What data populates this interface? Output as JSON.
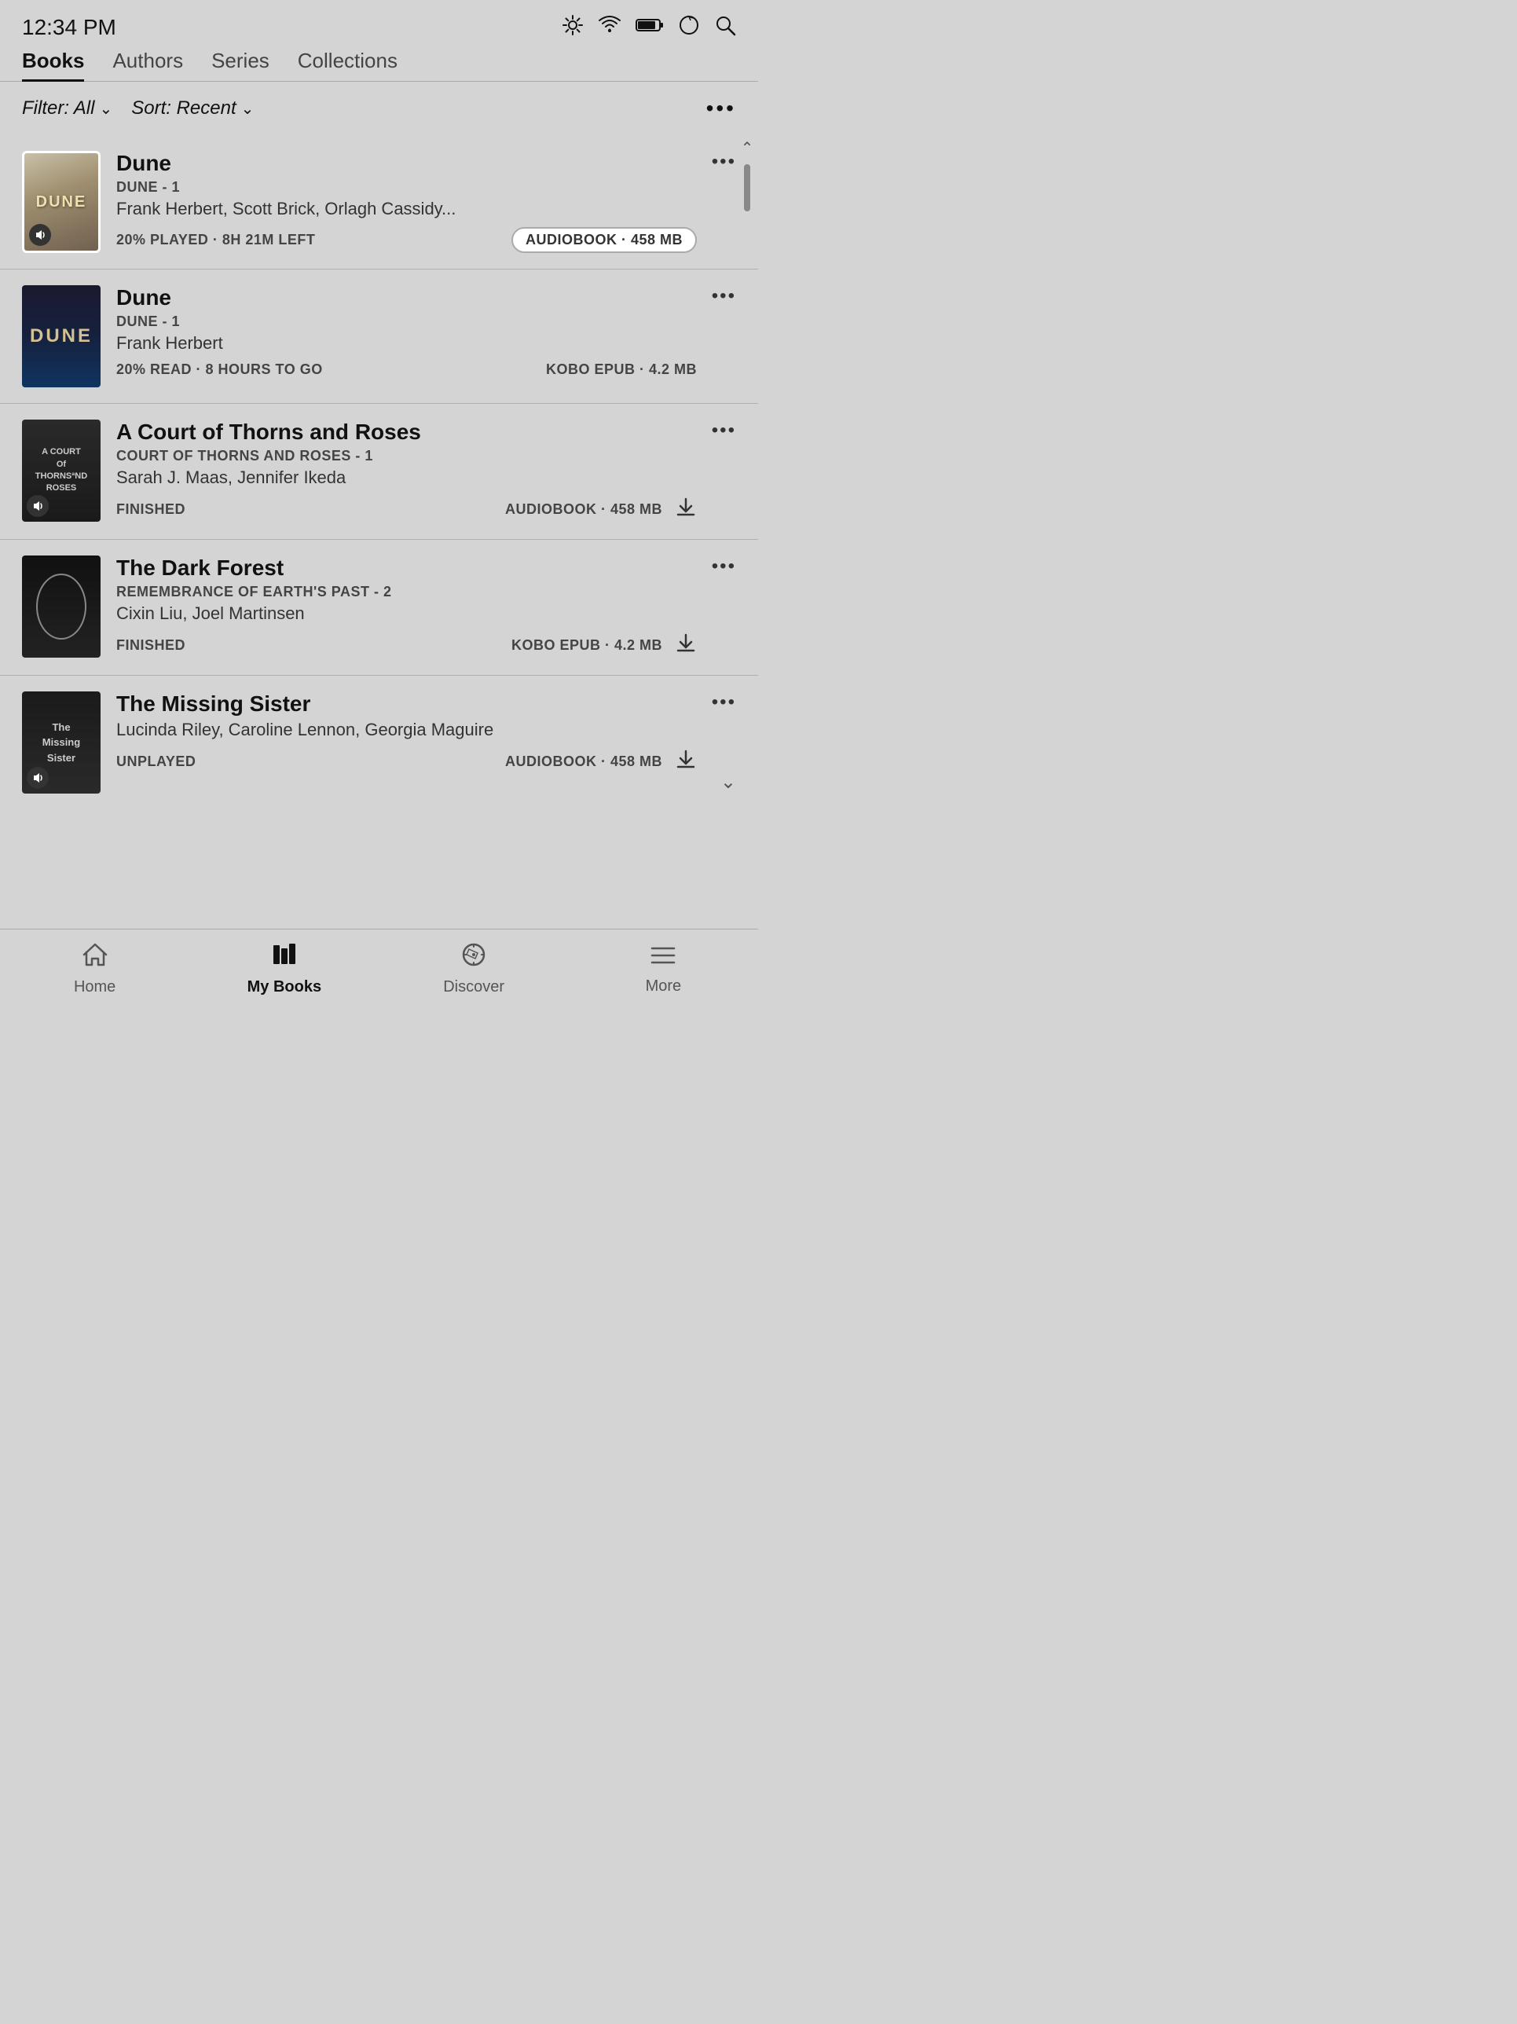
{
  "statusBar": {
    "time": "12:34 PM"
  },
  "tabs": [
    {
      "id": "books",
      "label": "Books",
      "active": true
    },
    {
      "id": "authors",
      "label": "Authors",
      "active": false
    },
    {
      "id": "series",
      "label": "Series",
      "active": false
    },
    {
      "id": "collections",
      "label": "Collections",
      "active": false
    }
  ],
  "filter": {
    "filterLabel": "Filter: All",
    "sortLabel": "Sort: Recent"
  },
  "books": [
    {
      "id": "dune-audio",
      "title": "Dune",
      "series": "DUNE - 1",
      "authors": "Frank Herbert, Scott Brick, Orlagh Cassidy...",
      "progress": "20% PLAYED · 8H 21M LEFT",
      "format": "AUDIOBOOK · 458 MB",
      "formatType": "audiobook-badge",
      "coverClass": "cover-dune-audio",
      "hasAudioBadge": true,
      "isActive": true
    },
    {
      "id": "dune-epub",
      "title": "Dune",
      "series": "DUNE - 1",
      "authors": "Frank Herbert",
      "progress": "20% READ · 8 HOURS TO GO",
      "format": "KOBO EPUB · 4.2 MB",
      "formatType": "text",
      "coverClass": "cover-dune-epub",
      "hasAudioBadge": false,
      "isActive": false
    },
    {
      "id": "acotar",
      "title": "A Court of Thorns and Roses",
      "series": "COURT OF THORNS AND ROSES - 1",
      "authors": "Sarah J. Maas, Jennifer Ikeda",
      "progress": "FINISHED",
      "format": "AUDIOBOOK · 458 MB",
      "formatType": "text",
      "coverClass": "cover-acotar",
      "hasAudioBadge": true,
      "isActive": false,
      "showDownload": true
    },
    {
      "id": "dark-forest",
      "title": "The Dark Forest",
      "series": "REMEMBRANCE OF EARTH'S PAST - 2",
      "authors": "Cixin Liu, Joel Martinsen",
      "progress": "FINISHED",
      "format": "KOBO EPUB · 4.2 MB",
      "formatType": "text",
      "coverClass": "cover-dark-forest",
      "hasAudioBadge": false,
      "isActive": false,
      "showDownload": true
    },
    {
      "id": "missing-sister",
      "title": "The Missing Sister",
      "series": "",
      "authors": "Lucinda Riley, Caroline Lennon, Georgia Maguire",
      "progress": "UNPLAYED",
      "format": "AUDIOBOOK · 458 MB",
      "formatType": "text",
      "coverClass": "cover-missing-sister",
      "hasAudioBadge": true,
      "isActive": false,
      "showDownload": true
    }
  ],
  "bottomNav": [
    {
      "id": "home",
      "label": "Home",
      "active": false,
      "icon": "home"
    },
    {
      "id": "mybooks",
      "label": "My Books",
      "active": true,
      "icon": "mybooks"
    },
    {
      "id": "discover",
      "label": "Discover",
      "active": false,
      "icon": "discover"
    },
    {
      "id": "more",
      "label": "More",
      "active": false,
      "icon": "more"
    }
  ],
  "labels": {
    "threeDotsLabel": "•••",
    "downloadArrow": "↓",
    "audioIcon": "♪",
    "scrollUp": "∧",
    "scrollDown": "∨"
  }
}
